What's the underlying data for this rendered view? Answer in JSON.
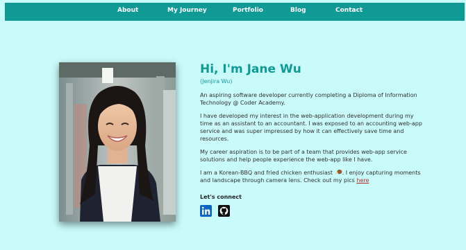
{
  "nav": {
    "items": [
      {
        "label": "About"
      },
      {
        "label": "My Journey"
      },
      {
        "label": "Portfolio"
      },
      {
        "label": "Blog"
      },
      {
        "label": "Contact"
      }
    ]
  },
  "hero": {
    "heading": "Hi, I'm Jane Wu",
    "subname": "(Jenjira Wu)",
    "p1": "An aspiring software developer currently completing a Diploma of Information Technology @ Coder Academy.",
    "p2": "I have developed my interest in the web-application development during my time as an assistant to an accountant. I was exposed to an accounting web-app service and was super impressed by how it can effectively save time and resources.",
    "p3": "My career aspiration is to be part of a team that provides web-app service solutions and help people experience the web-app like I have.",
    "p4_before": "I am a Korean-BBQ and fried chicken enthusiast ",
    "p4_after": ". I enjoy capturing moments and landscape through camera lens. Check out my pics ",
    "p4_link": "here",
    "connect_label": "Let's connect"
  },
  "icons": {
    "photo": "profile-photo",
    "chicken": "chicken-drumstick-icon",
    "linkedin": "linkedin-icon",
    "github": "github-icon"
  },
  "colors": {
    "navbar": "#0f9a96",
    "background": "#c9fbfb",
    "heading": "#0f9a96",
    "link": "#b22a2a",
    "linkedin": "#0a66c2"
  }
}
